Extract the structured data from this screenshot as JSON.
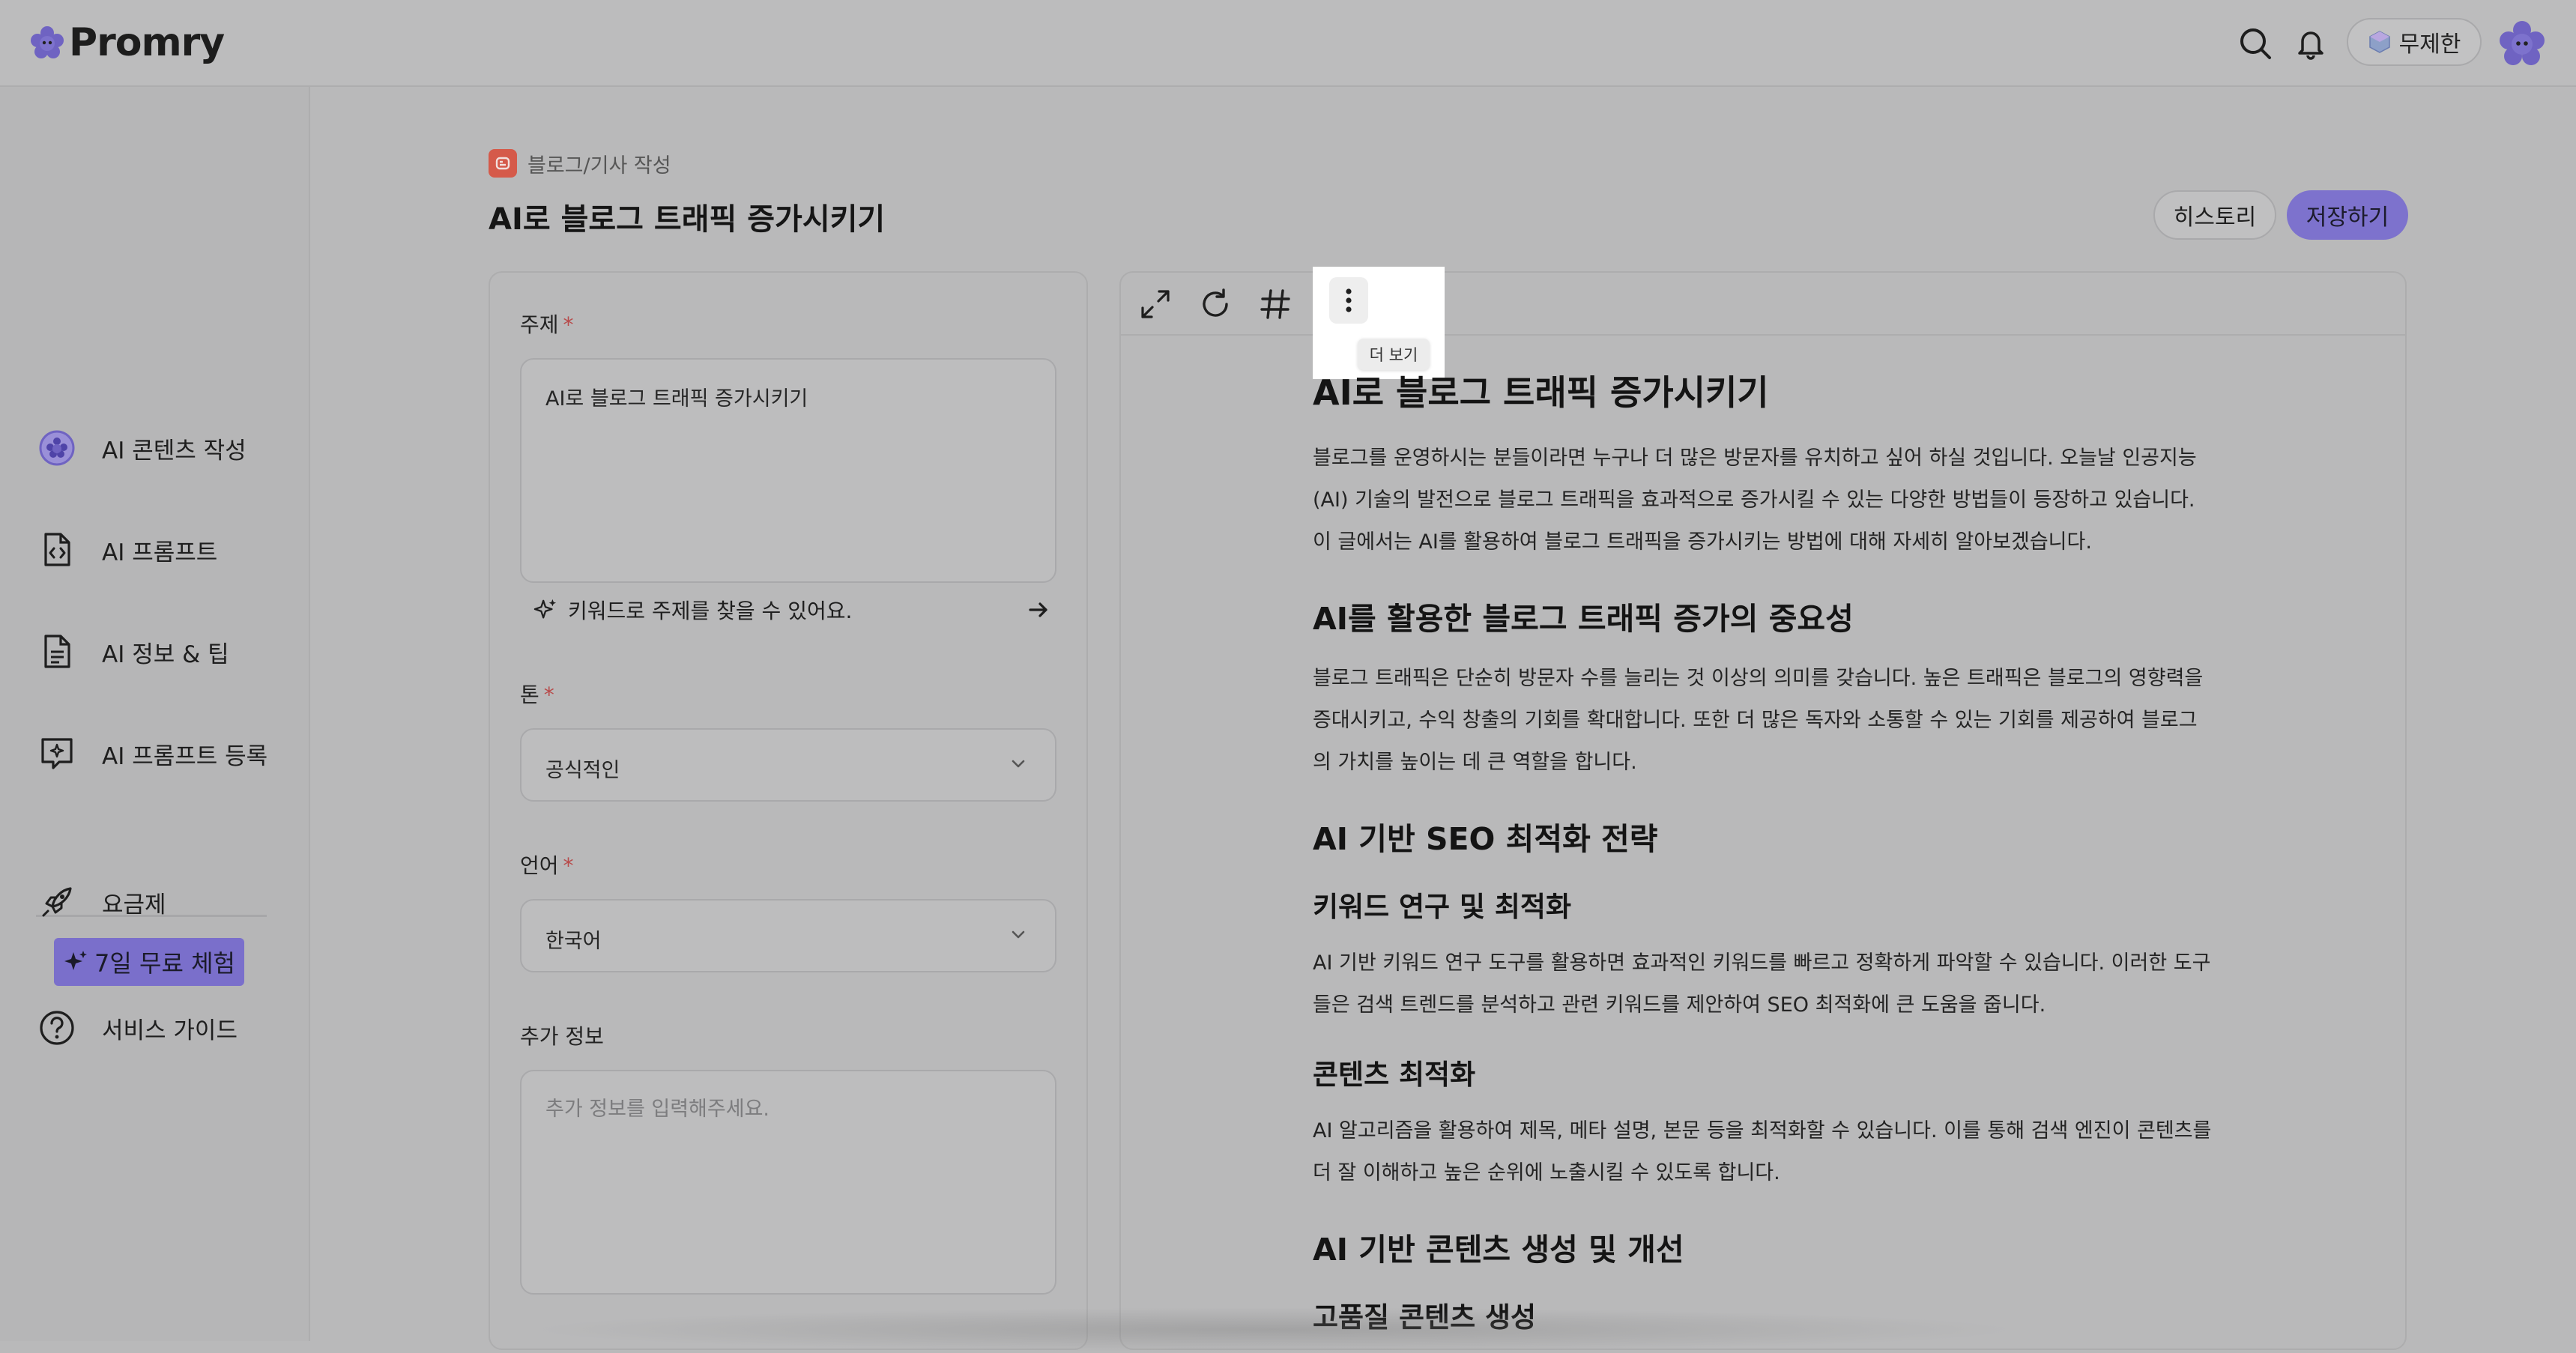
{
  "app": {
    "logo_text": "Promry",
    "plan_label": "무제한"
  },
  "sidebar": {
    "items": [
      {
        "label": "AI 콘텐츠 작성",
        "icon": "ai-content-icon"
      },
      {
        "label": "AI 프롬프트",
        "icon": "prompt-file-icon"
      },
      {
        "label": "AI 정보 & 팁",
        "icon": "document-icon"
      },
      {
        "label": "AI 프롬프트 등록",
        "icon": "add-prompt-icon"
      },
      {
        "label": "요금제",
        "icon": "rocket-icon"
      },
      {
        "label": "서비스 가이드",
        "icon": "help-icon"
      }
    ],
    "trial_label": "7일 무료 체험"
  },
  "page": {
    "breadcrumb": "블로그/기사 작성",
    "title": "AI로 블로그 트래픽 증가시키기",
    "history_label": "히스토리",
    "save_label": "저장하기"
  },
  "form": {
    "topic_label": "주제",
    "topic_value": "AI로 블로그 트래픽 증가시키기",
    "keyword_hint": "키워드로 주제를 찾을 수 있어요.",
    "tone_label": "톤",
    "tone_value": "공식적인",
    "language_label": "언어",
    "language_value": "한국어",
    "extra_label": "추가 정보",
    "extra_placeholder": "추가 정보를 입력해주세요.",
    "required_mark": "*"
  },
  "toolbar": {
    "more_tooltip": "더 보기"
  },
  "article": {
    "title": "AI로 블로그 트래픽 증가시키기",
    "intro": "블로그를 운영하시는 분들이라면 누구나 더 많은 방문자를 유치하고 싶어 하실 것입니다. 오늘날 인공지능(AI) 기술의 발전으로 블로그 트래픽을 효과적으로 증가시킬 수 있는 다양한 방법들이 등장하고 있습니다. 이 글에서는 AI를 활용하여 블로그 트래픽을 증가시키는 방법에 대해 자세히 알아보겠습니다.",
    "section1_title": "AI를 활용한 블로그 트래픽 증가의 중요성",
    "section1_body": "블로그 트래픽은 단순히 방문자 수를 늘리는 것 이상의 의미를 갖습니다. 높은 트래픽은 블로그의 영향력을 증대시키고, 수익 창출의 기회를 확대합니다. 또한 더 많은 독자와 소통할 수 있는 기회를 제공하여 블로그의 가치를 높이는 데 큰 역할을 합니다.",
    "section2_title": "AI 기반 SEO 최적화 전략",
    "sub1_title": "키워드 연구 및 최적화",
    "sub1_body": "AI 기반 키워드 연구 도구를 활용하면 효과적인 키워드를 빠르고 정확하게 파악할 수 있습니다. 이러한 도구들은 검색 트렌드를 분석하고 관련 키워드를 제안하여 SEO 최적화에 큰 도움을 줍니다.",
    "sub2_title": "콘텐츠 최적화",
    "sub2_body": "AI 알고리즘을 활용하여 제목, 메타 설명, 본문 등을 최적화할 수 있습니다. 이를 통해 검색 엔진이 콘텐츠를 더 잘 이해하고 높은 순위에 노출시킬 수 있도록 합니다.",
    "section3_title": "AI 기반 콘텐츠 생성 및 개선",
    "sub3_title": "고품질 콘텐츠 생성"
  },
  "colors": {
    "accent": "#7d72cd",
    "breadcrumb_icon": "#d55a4a",
    "required": "#b84a4a"
  }
}
